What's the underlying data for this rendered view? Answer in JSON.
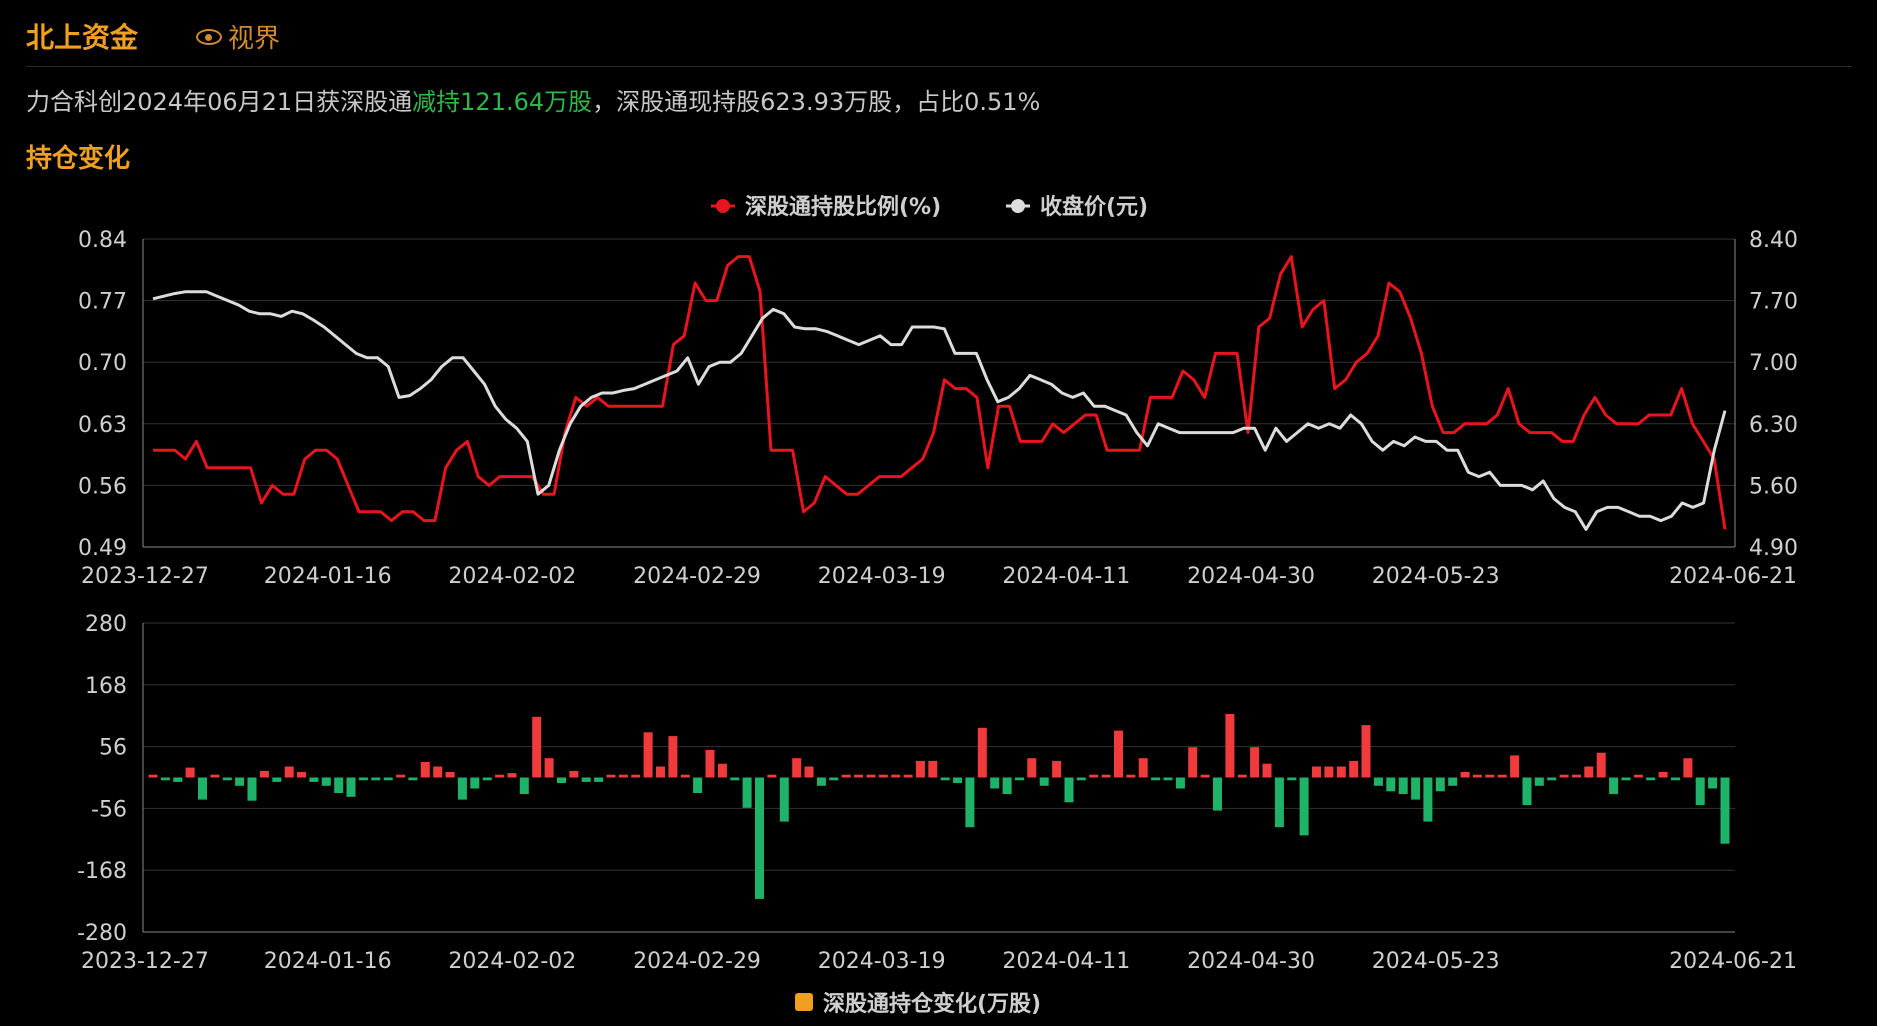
{
  "header": {
    "title": "北上资金",
    "view_label": "视界"
  },
  "summary": {
    "prefix": "力合科创2024年06月21日获深股通",
    "highlight": "减持121.64万股",
    "suffix": "，深股通现持股623.93万股，占比0.51%"
  },
  "section_title": "持仓变化",
  "colors": {
    "accent": "#f0a020",
    "ratio_line": "#e8141e",
    "price_line": "#dcdcdc",
    "bar_up": "#ef3b3b",
    "bar_down": "#1fb36a"
  },
  "chart_data": [
    {
      "type": "line",
      "legend": [
        {
          "name": "深股通持股比例(%)",
          "color": "#e8141e"
        },
        {
          "name": "收盘价(元)",
          "color": "#dcdcdc"
        }
      ],
      "legend_position": "top-center",
      "x_ticks": [
        "2023-12-27",
        "2024-01-16",
        "2024-02-02",
        "2024-02-29",
        "2024-03-19",
        "2024-04-11",
        "2024-04-30",
        "2024-05-23",
        "2024-06-21"
      ],
      "y_left_ticks": [
        "0.84",
        "0.77",
        "0.70",
        "0.63",
        "0.56",
        "0.49"
      ],
      "y_right_ticks": [
        "8.40",
        "7.70",
        "7.00",
        "6.30",
        "5.60",
        "4.90"
      ],
      "y_left_range": [
        0.49,
        0.84
      ],
      "y_right_range": [
        4.9,
        8.4
      ],
      "grid": true,
      "n_points": 120,
      "series": [
        {
          "name": "深股通持股比例(%)",
          "axis": "left",
          "values": [
            0.6,
            0.6,
            0.6,
            0.59,
            0.61,
            0.58,
            0.58,
            0.58,
            0.58,
            0.58,
            0.54,
            0.56,
            0.55,
            0.55,
            0.59,
            0.6,
            0.6,
            0.59,
            0.56,
            0.53,
            0.53,
            0.53,
            0.52,
            0.53,
            0.53,
            0.52,
            0.52,
            0.58,
            0.6,
            0.61,
            0.57,
            0.56,
            0.57,
            0.57,
            0.57,
            0.57,
            0.55,
            0.55,
            0.62,
            0.66,
            0.65,
            0.66,
            0.65,
            0.65,
            0.65,
            0.65,
            0.65,
            0.65,
            0.72,
            0.73,
            0.79,
            0.77,
            0.77,
            0.81,
            0.82,
            0.82,
            0.78,
            0.6,
            0.6,
            0.6,
            0.53,
            0.54,
            0.57,
            0.56,
            0.55,
            0.55,
            0.56,
            0.57,
            0.57,
            0.57,
            0.58,
            0.59,
            0.62,
            0.68,
            0.67,
            0.67,
            0.66,
            0.58,
            0.65,
            0.65,
            0.61,
            0.61,
            0.61,
            0.63,
            0.62,
            0.63,
            0.64,
            0.64,
            0.6,
            0.6,
            0.6,
            0.6,
            0.66,
            0.66,
            0.66,
            0.69,
            0.68,
            0.66,
            0.71,
            0.71,
            0.71,
            0.62,
            0.74,
            0.75,
            0.8,
            0.82,
            0.74,
            0.76,
            0.77,
            0.67,
            0.68,
            0.7,
            0.71,
            0.73,
            0.79,
            0.78,
            0.75,
            0.71,
            0.65,
            0.62,
            0.62,
            0.63,
            0.63,
            0.63,
            0.64,
            0.67,
            0.63,
            0.62,
            0.62,
            0.62,
            0.61,
            0.61,
            0.64,
            0.66,
            0.64,
            0.63,
            0.63,
            0.63,
            0.64,
            0.64,
            0.64,
            0.67,
            0.63,
            0.61,
            0.59,
            0.51
          ]
        },
        {
          "name": "收盘价(元)",
          "axis": "right",
          "values": [
            7.72,
            7.75,
            7.78,
            7.8,
            7.8,
            7.8,
            7.75,
            7.7,
            7.65,
            7.58,
            7.55,
            7.55,
            7.52,
            7.58,
            7.55,
            7.48,
            7.4,
            7.3,
            7.2,
            7.1,
            7.05,
            7.05,
            6.95,
            6.6,
            6.62,
            6.7,
            6.8,
            6.95,
            7.05,
            7.05,
            6.9,
            6.75,
            6.5,
            6.35,
            6.25,
            6.1,
            5.5,
            5.6,
            6.0,
            6.3,
            6.5,
            6.6,
            6.65,
            6.65,
            6.68,
            6.7,
            6.75,
            6.8,
            6.85,
            6.9,
            7.05,
            6.75,
            6.95,
            7.0,
            7.0,
            7.1,
            7.3,
            7.5,
            7.6,
            7.55,
            7.4,
            7.38,
            7.38,
            7.35,
            7.3,
            7.25,
            7.2,
            7.25,
            7.3,
            7.2,
            7.2,
            7.4,
            7.4,
            7.4,
            7.38,
            7.1,
            7.1,
            7.1,
            6.8,
            6.55,
            6.6,
            6.7,
            6.85,
            6.8,
            6.75,
            6.65,
            6.6,
            6.65,
            6.5,
            6.5,
            6.45,
            6.4,
            6.2,
            6.05,
            6.3,
            6.25,
            6.2,
            6.2,
            6.2,
            6.2,
            6.2,
            6.2,
            6.25,
            6.25,
            6.0,
            6.25,
            6.1,
            6.2,
            6.3,
            6.25,
            6.3,
            6.25,
            6.4,
            6.3,
            6.1,
            6.0,
            6.1,
            6.05,
            6.15,
            6.1,
            6.1,
            6.0,
            6.0,
            5.75,
            5.7,
            5.75,
            5.6,
            5.6,
            5.6,
            5.55,
            5.65,
            5.45,
            5.35,
            5.3,
            5.1,
            5.3,
            5.35,
            5.35,
            5.3,
            5.25,
            5.25,
            5.2,
            5.25,
            5.4,
            5.35,
            5.4,
            6.0,
            6.45
          ]
        }
      ]
    },
    {
      "type": "bar",
      "legend": [
        {
          "name": "深股通持仓变化(万股)",
          "color": "#f0a020"
        }
      ],
      "legend_position": "bottom-center",
      "x_ticks": [
        "2023-12-27",
        "2024-01-16",
        "2024-02-02",
        "2024-02-29",
        "2024-03-19",
        "2024-04-11",
        "2024-04-30",
        "2024-05-23",
        "2024-06-21"
      ],
      "y_ticks": [
        "280",
        "168",
        "56",
        "-56",
        "-168",
        "-280"
      ],
      "y_range": [
        -280,
        280
      ],
      "grid": true,
      "values": [
        5,
        -5,
        -8,
        18,
        -40,
        5,
        -5,
        -15,
        -42,
        12,
        -8,
        20,
        10,
        -8,
        -15,
        -28,
        -35,
        -5,
        -5,
        -5,
        5,
        -5,
        28,
        20,
        10,
        -40,
        -20,
        -5,
        5,
        8,
        -30,
        110,
        35,
        -10,
        12,
        -8,
        -8,
        5,
        5,
        5,
        82,
        20,
        75,
        5,
        -28,
        50,
        25,
        -5,
        -55,
        -220,
        5,
        -80,
        35,
        20,
        -15,
        -5,
        5,
        5,
        5,
        5,
        5,
        5,
        30,
        30,
        -5,
        -10,
        -90,
        90,
        -20,
        -30,
        -5,
        35,
        -15,
        30,
        -45,
        -5,
        5,
        5,
        85,
        5,
        35,
        -5,
        -5,
        -20,
        55,
        5,
        -60,
        115,
        5,
        55,
        25,
        -90,
        -5,
        -105,
        20,
        20,
        20,
        30,
        95,
        -15,
        -25,
        -30,
        -40,
        -80,
        -25,
        -15,
        10,
        5,
        5,
        5,
        40,
        -50,
        -15,
        -5,
        5,
        5,
        20,
        45,
        -30,
        -5,
        5,
        -5,
        10,
        -5,
        35,
        -50,
        -20,
        -120
      ]
    }
  ]
}
